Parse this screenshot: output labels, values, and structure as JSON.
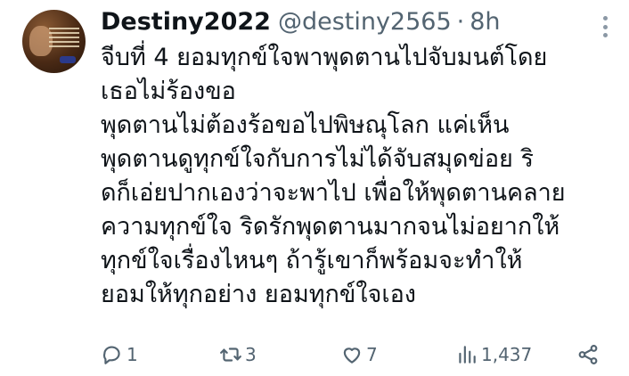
{
  "tweet": {
    "display_name": "Destiny2022",
    "handle": "@destiny2565",
    "separator": "·",
    "time": "8h",
    "lines": [
      "จีบที่ 4 ยอมทุกข์ใจพาพุดตานไปจับมนต์โดย",
      "เธอไม่ร้องขอ",
      "พุดตานไม่ต้องร้อขอไปพิษณุโลก แค่เห็น",
      "พุดตานดูทุกข์ใจกับการไม่ได้จับสมุดข่อย ริ",
      "ดก็เอ่ยปากเองว่าจะพาไป เพื่อให้พุดตานคลาย",
      "ความทุกข์ใจ ริดรักพุดตานมากจนไม่อยากให้",
      "ทุกข์ใจเรื่องไหนๆ ถ้ารู้เขาก็พร้อมจะทำให้",
      "ยอมให้ทุกอย่าง ยอมทุกข์ใจเอง"
    ]
  },
  "actions": {
    "reply_count": "1",
    "retweet_count": "3",
    "like_count": "7",
    "view_count": "1,437"
  },
  "icons": {
    "reply": "reply-icon",
    "retweet": "retweet-icon",
    "like": "heart-icon",
    "views": "views-icon",
    "share": "share-icon",
    "more": "more-icon"
  },
  "colors": {
    "text": "#0f1419",
    "secondary": "#536471",
    "background": "#ffffff"
  }
}
